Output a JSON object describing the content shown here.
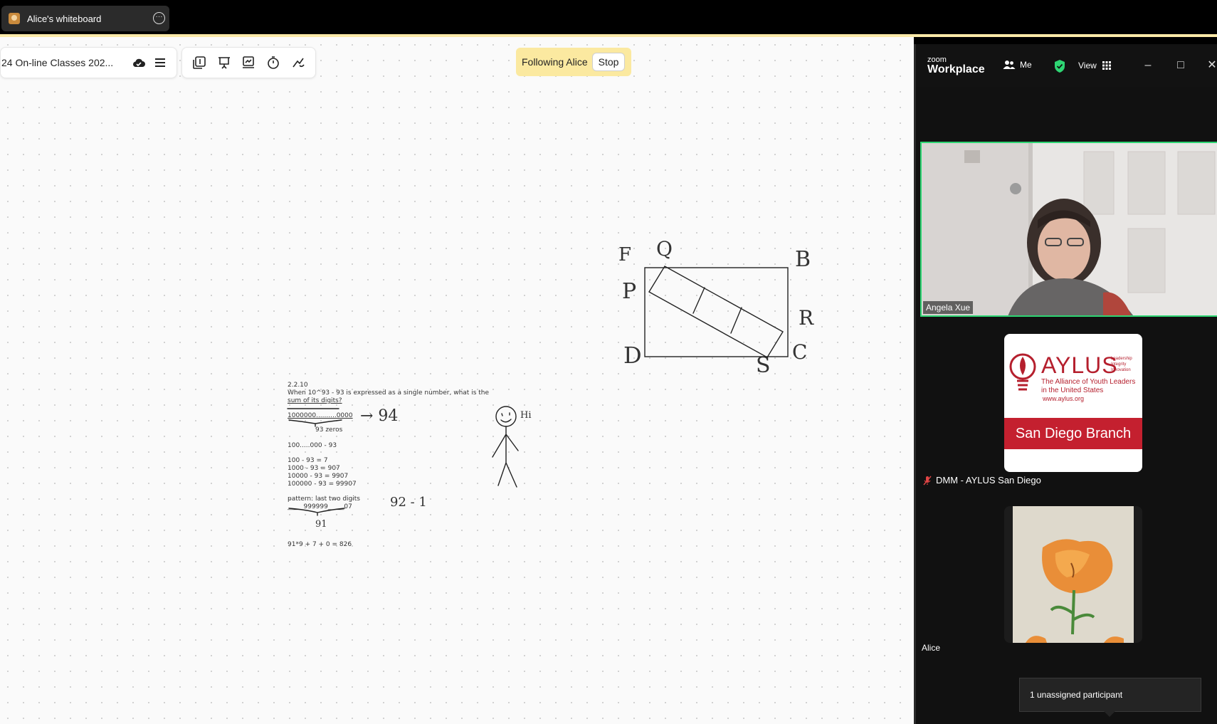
{
  "window": {
    "tab_title": "Alice's whiteboard"
  },
  "whiteboard": {
    "board_name": "24 On-line Classes 202...",
    "following_label": "Following Alice",
    "stop_label": "Stop",
    "notes": {
      "problem_id": "2.2.10",
      "question_line1": "When 10^93 - 93 is expressed as a single number, what is the",
      "question_line2": "sum of its digits?",
      "big_number": "1000000..........0000",
      "zeros_note": "93 zeros",
      "subtraction": "100.....000 - 93",
      "ex1": "100 - 93 = 7",
      "ex2": "1000 - 93 = 907",
      "ex3": "10000 - 93 = 9907",
      "ex4": "100000 - 93 = 99907",
      "pattern": "pattern: last two digits",
      "pattern_digits": "_____999999_____07",
      "count_91": "91",
      "answer": "91*9 + 7 + 0 = 826",
      "arrow_94": "→ 94",
      "note_92": "92 - 1",
      "hi": "Hi"
    },
    "geometry_labels": {
      "F": "F",
      "Q": "Q",
      "B": "B",
      "P": "P",
      "R": "R",
      "D": "D",
      "S": "S",
      "C": "C"
    }
  },
  "zoom": {
    "logo_small": "zoom",
    "logo_big": "Workplace",
    "members_label": "Me",
    "view_label": "View",
    "participants": [
      {
        "name": "Angela Xue"
      },
      {
        "name": "DMM - AYLUS San Diego"
      },
      {
        "name": "Alice"
      }
    ],
    "aylus": {
      "title": "AYLUS",
      "tag1": "Leadership",
      "tag2": "Integrity",
      "tag3": "Innovation",
      "line1": "The Alliance of Youth Leaders",
      "line2": "in the United States",
      "url": "www.aylus.org",
      "branch": "San Diego Branch"
    },
    "tooltip": "1 unassigned participant"
  }
}
